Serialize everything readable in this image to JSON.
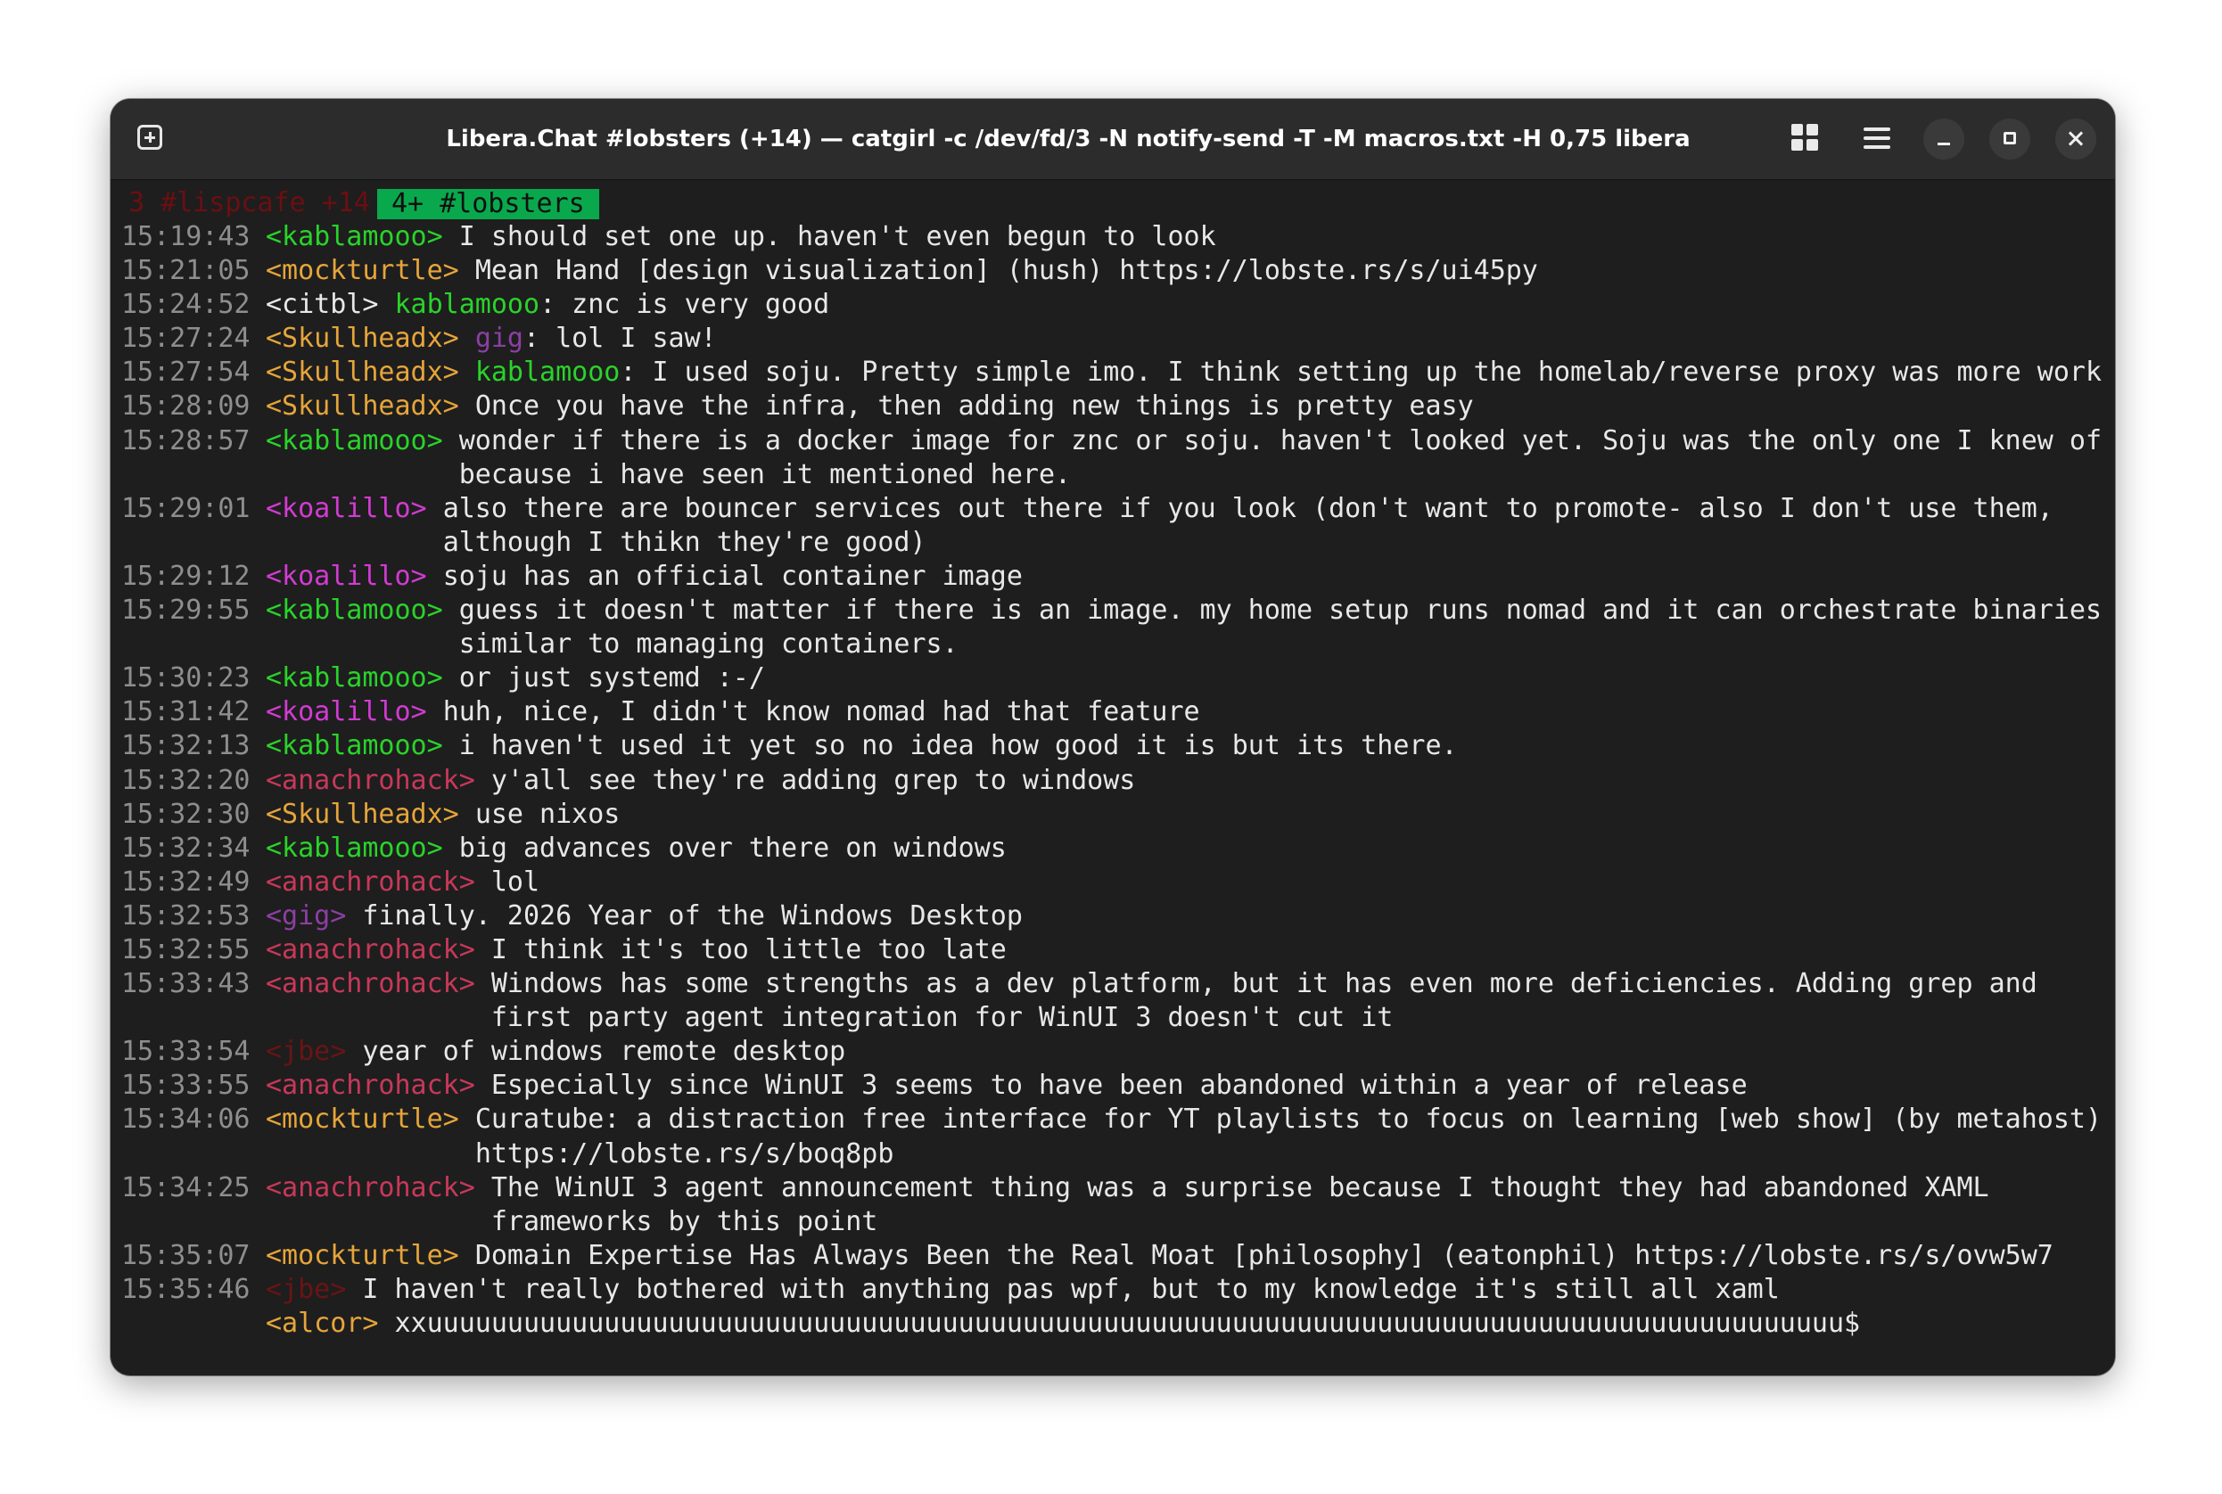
{
  "window": {
    "title": "Libera.Chat #lobsters (+14) — catgirl -c /dev/fd/3 -N notify-send -T -M macros.txt -H 0,75 libera"
  },
  "colors": {
    "green": "#2ad32a",
    "orange": "#e6a53a",
    "magenta": "#d23bd2",
    "red": "#c8385a",
    "purple": "#8c3fa3",
    "darkred": "#6a1414",
    "timestamp": "#8e8e8e",
    "active_tab_bg": "#0aa84c"
  },
  "tabs": {
    "inactive": "3 #lispcafe +14",
    "active": "4+ #lobsters"
  },
  "messages": [
    {
      "time": "15:19:43",
      "nick": "<kablamooo>",
      "color": "green",
      "text": "I should set one up. haven't even begun to look"
    },
    {
      "time": "15:21:05",
      "nick": "<mockturtle>",
      "color": "orange",
      "text": "Mean Hand [design visualization] (hush) https://lobste.rs/s/ui45py"
    },
    {
      "time": "15:24:52",
      "nick": "<citbl>",
      "color": "default",
      "mention": "kablamooo",
      "mention_color": "green",
      "text": ": znc is very good"
    },
    {
      "time": "15:27:24",
      "nick": "<Skullheadx>",
      "color": "orange",
      "mention": "gig",
      "mention_color": "purple",
      "text": ": lol I saw!"
    },
    {
      "time": "15:27:54",
      "nick": "<Skullheadx>",
      "color": "orange",
      "mention": "kablamooo",
      "mention_color": "green",
      "text": ": I used soju. Pretty simple imo. I think setting up the homelab/reverse proxy was more work"
    },
    {
      "time": "15:28:09",
      "nick": "<Skullheadx>",
      "color": "orange",
      "text": "Once you have the infra, then adding new things is pretty easy"
    },
    {
      "time": "15:28:57",
      "nick": "<kablamooo>",
      "color": "green",
      "text": "wonder if there is a docker image for znc or soju. haven't looked yet. Soju was the only one I knew of because i have seen it mentioned here."
    },
    {
      "time": "15:29:01",
      "nick": "<koalillo>",
      "color": "magenta",
      "text": "also there are bouncer services out there if you look (don't want to promote- also I don't use them, although I thikn they're good)"
    },
    {
      "time": "15:29:12",
      "nick": "<koalillo>",
      "color": "magenta",
      "text": "soju has an official container image"
    },
    {
      "time": "15:29:55",
      "nick": "<kablamooo>",
      "color": "green",
      "text": "guess it doesn't matter if there is an image. my home setup runs nomad and it can orchestrate binaries similar to managing containers."
    },
    {
      "time": "15:30:23",
      "nick": "<kablamooo>",
      "color": "green",
      "text": "or just systemd :-/"
    },
    {
      "time": "15:31:42",
      "nick": "<koalillo>",
      "color": "magenta",
      "text": "huh, nice, I didn't know nomad had that feature"
    },
    {
      "time": "15:32:13",
      "nick": "<kablamooo>",
      "color": "green",
      "text": "i haven't used it yet so no idea how good it is but its there."
    },
    {
      "time": "15:32:20",
      "nick": "<anachrohack>",
      "color": "red",
      "text": "y'all see they're adding grep to windows"
    },
    {
      "time": "15:32:30",
      "nick": "<Skullheadx>",
      "color": "orange",
      "text": "use nixos"
    },
    {
      "time": "15:32:34",
      "nick": "<kablamooo>",
      "color": "green",
      "text": "big advances over there on windows"
    },
    {
      "time": "15:32:49",
      "nick": "<anachrohack>",
      "color": "red",
      "text": "lol"
    },
    {
      "time": "15:32:53",
      "nick": "<gig>",
      "color": "purple",
      "text": "finally. 2026 Year of the Windows Desktop"
    },
    {
      "time": "15:32:55",
      "nick": "<anachrohack>",
      "color": "red",
      "text": "I think it's too little too late"
    },
    {
      "time": "15:33:43",
      "nick": "<anachrohack>",
      "color": "red",
      "text": "Windows has some strengths as a dev platform, but it has even more deficiencies. Adding grep and first party agent integration for WinUI 3 doesn't cut it"
    },
    {
      "time": "15:33:54",
      "nick": "<jbe>",
      "color": "darkred",
      "text": "year of windows remote desktop"
    },
    {
      "time": "15:33:55",
      "nick": "<anachrohack>",
      "color": "red",
      "text": "Especially since WinUI 3 seems to have been abandoned within a year of release"
    },
    {
      "time": "15:34:06",
      "nick": "<mockturtle>",
      "color": "orange",
      "text": "Curatube: a distraction free interface for YT playlists to focus on learning [web show] (by metahost) https://lobste.rs/s/boq8pb"
    },
    {
      "time": "15:34:25",
      "nick": "<anachrohack>",
      "color": "red",
      "text": "The WinUI 3 agent announcement thing was a surprise because I thought they had abandoned XAML frameworks by this point"
    },
    {
      "time": "15:35:07",
      "nick": "<mockturtle>",
      "color": "orange",
      "text": "Domain Expertise Has Always Been the Real Moat [philosophy] (eatonphil) https://lobste.rs/s/ovw5w7"
    },
    {
      "time": "15:35:46",
      "nick": "<jbe>",
      "color": "darkred",
      "text": "I haven't really bothered with anything pas wpf, but to my knowledge it's still all xaml"
    }
  ],
  "input": {
    "nick": "<alcor>",
    "text": "xxuuuuuuuuuuuuuuuuuuuuuuuuuuuuuuuuuuuuuuuuuuuuuuuuuuuuuuuuuuuuuuuuuuuuuuuuuuuuuuuuuuuuuuuu$"
  }
}
